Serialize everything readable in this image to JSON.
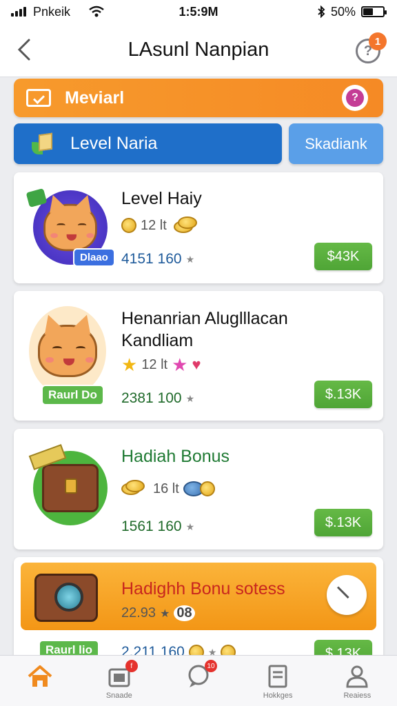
{
  "status_bar": {
    "carrier": "Pnkeik",
    "time": "1:5:9M",
    "battery": "50%",
    "battery_level": 0.5
  },
  "header": {
    "title": "LAsunl Nanpian",
    "help_badge": "1",
    "help_symbol": "?"
  },
  "banner": {
    "label": "Meviarl",
    "chat_symbol": "?"
  },
  "level_button": {
    "label": "Level Naria"
  },
  "side_button": {
    "label": "Skadiank"
  },
  "cards": [
    {
      "title": "Level Haiy",
      "stat_value": "12 lt",
      "price_left": "4151 160",
      "price_button": "$43K",
      "tag": "Dlaao",
      "colors": {
        "title": "#111111",
        "price": "#1e5a9a"
      }
    },
    {
      "title_line1": "Henanrian Aluglllacan",
      "title_line2": "Kandliam",
      "stat_value": "12 lt",
      "price_left": "2381 100",
      "price_button": "$.13K",
      "tag": "Raurl Do",
      "colors": {
        "title": "#111111",
        "price": "#1f6a2a"
      }
    },
    {
      "title": "Hadiah Bonus",
      "stat_value": "16 lt",
      "price_left": "1561 160",
      "price_button": "$.13K",
      "colors": {
        "title": "#1f7a33",
        "price": "#1f6a2a"
      }
    },
    {
      "title": "Hadighh Bonu sotess",
      "stat_value": "22.93",
      "stat_extra": "08",
      "price_left": "2.211 160",
      "price_button": "$.13K",
      "tag": "Raurl lio",
      "colors": {
        "title": "#c8261e",
        "banner": "#f59a1a"
      }
    }
  ],
  "bottom_nav": [
    {
      "label": "",
      "icon": "home-icon",
      "active": true
    },
    {
      "label": "Snaade",
      "icon": "shop-icon",
      "badge": "f"
    },
    {
      "label": "",
      "icon": "chat-icon",
      "badge": "10"
    },
    {
      "label": "Hokkges",
      "icon": "document-icon"
    },
    {
      "label": "Reaiess",
      "icon": "profile-icon"
    }
  ]
}
